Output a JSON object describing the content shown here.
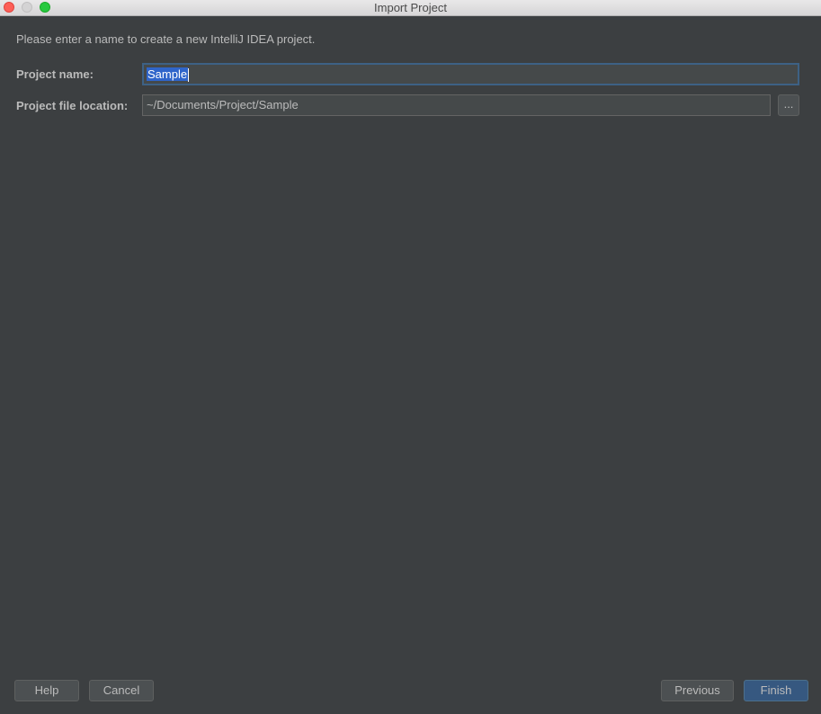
{
  "window": {
    "title": "Import Project"
  },
  "form": {
    "intro_text": "Please enter a name to create a new IntelliJ IDEA project.",
    "project_name_label": "Project name:",
    "project_name_value": "Sample",
    "project_location_label": "Project file location:",
    "project_location_value": "~/Documents/Project/Sample",
    "browse_label": "..."
  },
  "footer": {
    "help_label": "Help",
    "cancel_label": "Cancel",
    "previous_label": "Previous",
    "finish_label": "Finish"
  },
  "colors": {
    "background": "#3c3f41",
    "text": "#bbbbbb",
    "selection": "#2f65ca",
    "focus_border": "#3d6185",
    "default_button": "#365880"
  }
}
